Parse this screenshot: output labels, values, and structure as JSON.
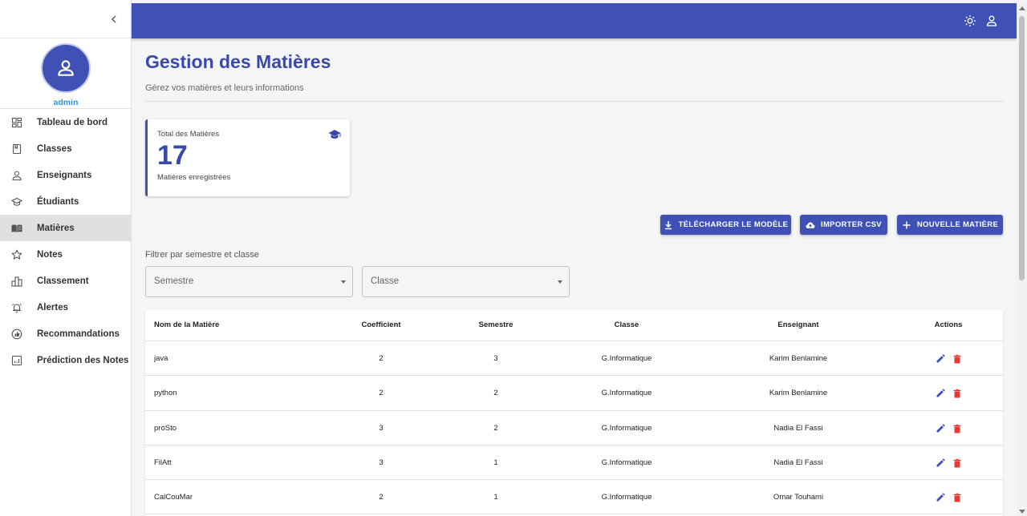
{
  "sidebar": {
    "admin_name": "admin",
    "items": [
      {
        "label": "Tableau de bord",
        "icon": "dashboard-icon"
      },
      {
        "label": "Classes",
        "icon": "book-icon"
      },
      {
        "label": "Enseignants",
        "icon": "person-icon"
      },
      {
        "label": "Étudiants",
        "icon": "school-icon"
      },
      {
        "label": "Matières",
        "icon": "open-book-icon",
        "active": true
      },
      {
        "label": "Notes",
        "icon": "star-icon"
      },
      {
        "label": "Classement",
        "icon": "ranking-icon"
      },
      {
        "label": "Alertes",
        "icon": "alarm-icon"
      },
      {
        "label": "Recommandations",
        "icon": "recommend-icon"
      },
      {
        "label": "Prédiction des Notes",
        "icon": "analytics-icon"
      }
    ]
  },
  "header": {
    "accent": "#3f51b5"
  },
  "page": {
    "title": "Gestion des Matières",
    "subtitle": "Gérez vos matières et leurs informations"
  },
  "stat": {
    "label": "Total des Matières",
    "value": "17",
    "sub": "Matières enregistrées"
  },
  "actions": {
    "download": "TÉLÉCHARGER LE MODÈLE",
    "import": "IMPORTER CSV",
    "new": "NOUVELLE MATIÈRE"
  },
  "filters": {
    "title": "Filtrer par semestre et classe",
    "semestre": "Semestre",
    "classe": "Classe"
  },
  "table": {
    "headers": [
      "Nom de la Matière",
      "Coefficient",
      "Semestre",
      "Classe",
      "Enseignant",
      "Actions"
    ],
    "rows": [
      {
        "nom": "java",
        "coef": "2",
        "sem": "3",
        "classe": "G.Informatique",
        "ens": "Karim Benlamine"
      },
      {
        "nom": "python",
        "coef": "2",
        "sem": "2",
        "classe": "G.Informatique",
        "ens": "Karim Benlamine"
      },
      {
        "nom": "proSto",
        "coef": "3",
        "sem": "2",
        "classe": "G.Informatique",
        "ens": "Nadia El Fassi"
      },
      {
        "nom": "FilAtt",
        "coef": "3",
        "sem": "1",
        "classe": "G.Informatique",
        "ens": "Nadia El Fassi"
      },
      {
        "nom": "CalCouMar",
        "coef": "2",
        "sem": "1",
        "classe": "G.Informatique",
        "ens": "Omar Touhami"
      }
    ]
  }
}
